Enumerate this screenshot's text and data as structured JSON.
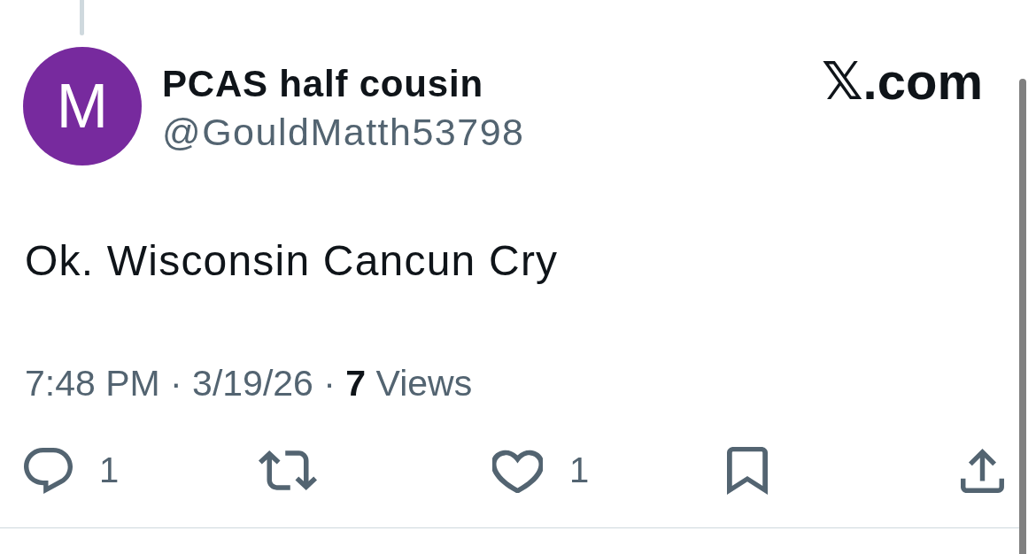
{
  "author": {
    "avatar_letter": "M",
    "name": "PCAS half cousin",
    "handle": "@GouldMatth53798"
  },
  "site_logo": "𝕏.com",
  "post": {
    "text": "Ok. Wisconsin Cancun Cry",
    "meta": "7:48 PM · 3/19/26 · **7** Views"
  },
  "actions": [
    {
      "kind": "reply",
      "count": "1"
    },
    {
      "kind": "repost"
    },
    {
      "kind": "like",
      "count": "1"
    },
    {
      "kind": "bookmark"
    },
    {
      "kind": "share"
    }
  ]
}
